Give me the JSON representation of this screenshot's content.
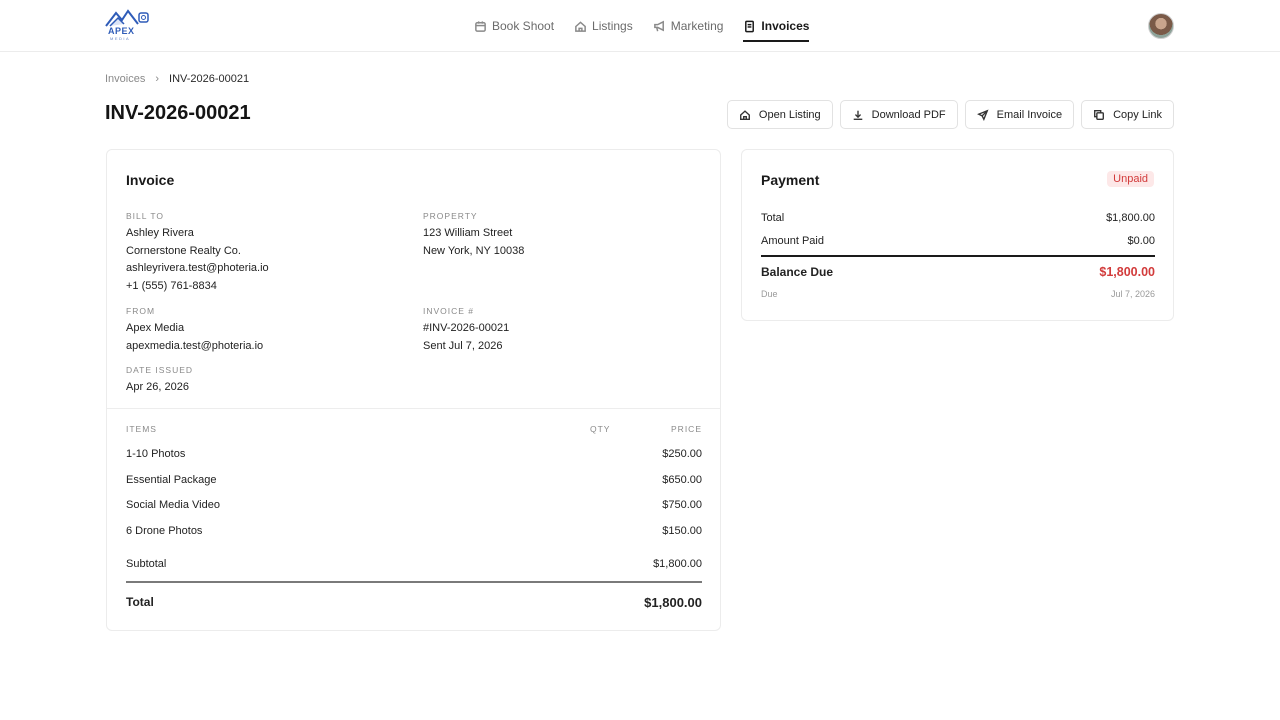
{
  "brand": {
    "logo_text": "APEX",
    "logo_sub": "MEDIA",
    "accent": "#2f5cb8"
  },
  "nav": {
    "items": [
      {
        "label": "Book Shoot",
        "icon": "calendar-icon"
      },
      {
        "label": "Listings",
        "icon": "home-icon"
      },
      {
        "label": "Marketing",
        "icon": "megaphone-icon"
      },
      {
        "label": "Invoices",
        "icon": "receipt-icon",
        "active": true
      }
    ]
  },
  "breadcrumb": {
    "parent": "Invoices",
    "separator": "›",
    "current": "INV-2026-00021"
  },
  "page": {
    "title": "INV-2026-00021"
  },
  "actions": {
    "open_listing": "Open Listing",
    "download_pdf": "Download PDF",
    "email_invoice": "Email Invoice",
    "copy_link": "Copy Link"
  },
  "invoice": {
    "title": "Invoice",
    "bill_to": {
      "label": "BILL TO",
      "name": "Ashley Rivera",
      "company": "Cornerstone Realty Co.",
      "email": "ashleyrivera.test@photeria.io",
      "phone": "+1 (555) 761-8834"
    },
    "property": {
      "label": "PROPERTY",
      "street": "123 William Street",
      "city": "New York, NY 10038"
    },
    "from": {
      "label": "FROM",
      "name": "Apex Media",
      "email": "apexmedia.test@photeria.io"
    },
    "invoice_no": {
      "label": "INVOICE #",
      "number": "#INV-2026-00021",
      "sent": "Sent Jul 7, 2026"
    },
    "date_issued": {
      "label": "DATE ISSUED",
      "value": "Apr 26, 2026"
    },
    "items_header": {
      "items": "ITEMS",
      "qty": "QTY",
      "price": "PRICE"
    },
    "items": [
      {
        "name": "1-10 Photos",
        "price": "$250.00"
      },
      {
        "name": "Essential Package",
        "price": "$650.00"
      },
      {
        "name": "Social Media Video",
        "price": "$750.00"
      },
      {
        "name": "6 Drone Photos",
        "price": "$150.00"
      }
    ],
    "subtotal": {
      "label": "Subtotal",
      "value": "$1,800.00"
    },
    "total": {
      "label": "Total",
      "value": "$1,800.00"
    }
  },
  "payment": {
    "title": "Payment",
    "status": "Unpaid",
    "status_color": "#d23b3b",
    "total": {
      "label": "Total",
      "value": "$1,800.00"
    },
    "amount_paid": {
      "label": "Amount Paid",
      "value": "$0.00"
    },
    "balance_due": {
      "label": "Balance Due",
      "value": "$1,800.00"
    },
    "due": {
      "label": "Due",
      "value": "Jul 7, 2026"
    }
  }
}
